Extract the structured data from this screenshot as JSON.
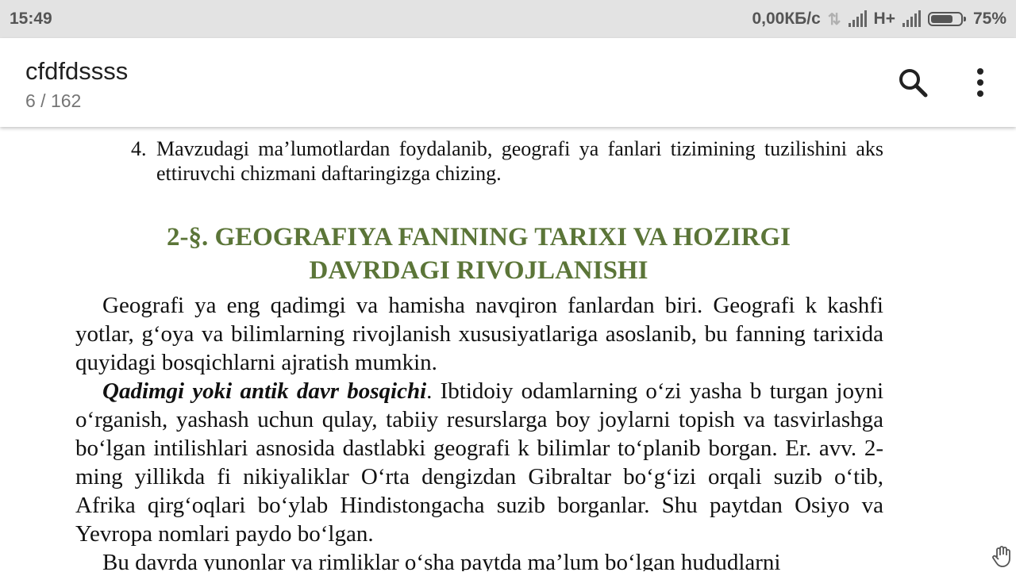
{
  "status_bar": {
    "time": "15:49",
    "network_speed": "0,00КБ/с",
    "network_type": "H+",
    "battery_percent": "75%",
    "battery_level": 0.75,
    "icons": [
      "data-arrows-icon",
      "signal-icon",
      "battery-icon"
    ]
  },
  "app_bar": {
    "title": "cfdfdssss",
    "page_indicator": "6 / 162",
    "icons": [
      "search-icon",
      "more-vert-icon"
    ]
  },
  "document": {
    "list_item": {
      "number": "4.",
      "text": "Mavzudagi ma’lumotlardan foydalanib, geografi ya fanlari tizimining tuzilishini aks ettiruvchi chizmani daftaringizga chizing."
    },
    "heading_line1": "2-§. GEOGRAFIYA FANINING TARIXI VA HOZIRGI",
    "heading_line2": "DAVRDAGI RIVOJLANISHI",
    "heading_color": "#5b7538",
    "paragraph1": "Geografi ya eng qadimgi va hamisha navqiron fanlardan biri. Geografi k kashfi yotlar, g‘oya va bilimlarning rivojlanish xususiyatlariga asoslanib, bu fanning tarixida quyidagi bosqichlarni ajratish mumkin.",
    "paragraph2_bold": "Qadimgi yoki antik davr bosqichi",
    "paragraph2_rest": ". Ibtidoiy odamlarning o‘zi yasha b turgan joyni o‘rganish, yashash uchun qulay, tabiiy resurslarga boy joylarni topish va tasvirlashga bo‘lgan intilishlari asnosida dastlabki geografi k bilimlar to‘planib borgan. Er. avv. 2-ming yillikda fi nikiyaliklar O‘rta dengizdan Gibraltar bo‘g‘izi orqali suzib o‘tib, Afrika qirg‘oqlari bo‘ylab Hindistongacha suzib borganlar. Shu paytdan Osiyo va Yevropa nomlari paydo bo‘lgan.",
    "paragraph3": "Bu davrda yunonlar va rimliklar o‘sha paytda ma’lum bo‘lgan hududlarni"
  },
  "overlay": {
    "icon": "hand-gesture-icon"
  }
}
